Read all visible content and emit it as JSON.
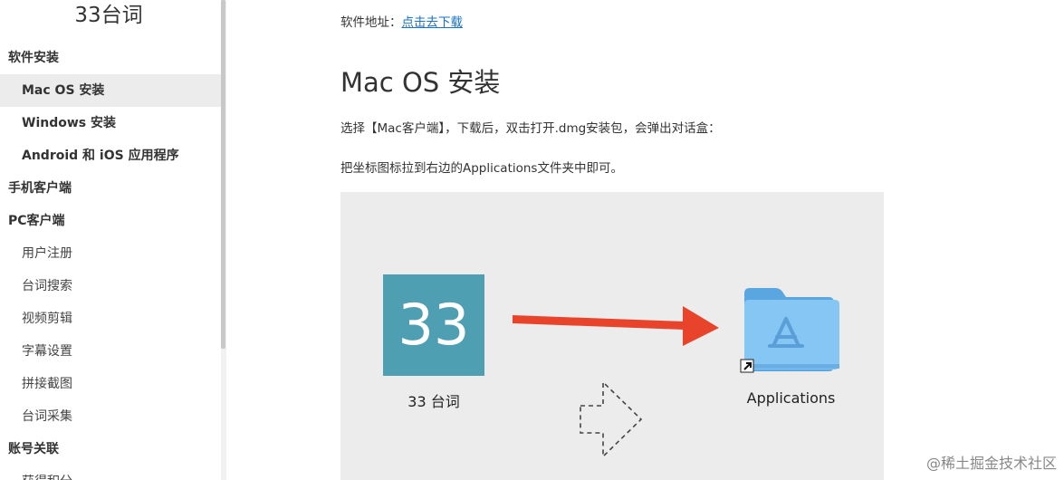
{
  "sidebar": {
    "site_title": "33台词",
    "items": [
      {
        "label": "软件安装",
        "kind": "group"
      },
      {
        "label": "Mac OS 安装",
        "kind": "sub-bold",
        "active": true
      },
      {
        "label": "Windows 安装",
        "kind": "sub-bold"
      },
      {
        "label": "Android 和 iOS 应用程序",
        "kind": "sub-bold"
      },
      {
        "label": "手机客户端",
        "kind": "group"
      },
      {
        "label": "PC客户端",
        "kind": "group"
      },
      {
        "label": "用户注册",
        "kind": "sub"
      },
      {
        "label": "台词搜索",
        "kind": "sub"
      },
      {
        "label": "视频剪辑",
        "kind": "sub"
      },
      {
        "label": "字幕设置",
        "kind": "sub"
      },
      {
        "label": "拼接截图",
        "kind": "sub"
      },
      {
        "label": "台词采集",
        "kind": "sub"
      },
      {
        "label": "账号关联",
        "kind": "group"
      },
      {
        "label": "获得积分",
        "kind": "sub"
      }
    ]
  },
  "content": {
    "download_prefix": "软件地址：",
    "download_link": "点击去下载",
    "heading": "Mac OS 安装",
    "para1": "选择【Mac客户端】，下载后，双击打开.dmg安装包，会弹出对话盒：",
    "para2": "把坐标图标拉到右边的Applications文件夹中即可。",
    "figure": {
      "app_icon_text": "33",
      "app_name": "33 台词",
      "folder_name": "Applications",
      "arrow_color": "#e8442c",
      "folder_color": "#7cc1f2"
    }
  },
  "watermark": "@稀土掘金技术社区"
}
